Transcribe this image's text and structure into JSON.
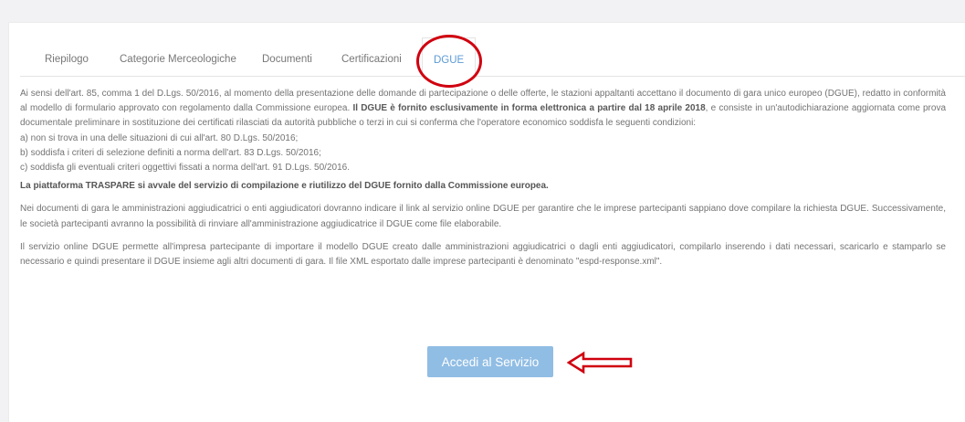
{
  "tabs": [
    {
      "label": "Riepilogo"
    },
    {
      "label": "Categorie Merceologiche"
    },
    {
      "label": "Documenti"
    },
    {
      "label": "Certificazioni"
    },
    {
      "label": "DGUE"
    }
  ],
  "content": {
    "intro_before_bold": "Ai sensi dell'art. 85, comma 1 del D.Lgs. 50/2016, al momento della presentazione delle domande di partecipazione o delle offerte, le stazioni appaltanti accettano il documento di gara unico europeo (DGUE), redatto in conformità al modello di formulario approvato con regolamento dalla Commissione europea. ",
    "intro_bold": "Il DGUE è fornito esclusivamente in forma elettronica a partire dal 18 aprile 2018",
    "intro_after_bold": ", e consiste in un'autodichiarazione aggiornata come prova documentale preliminare in sostituzione dei certificati rilasciati da autorità pubbliche o terzi in cui si conferma che l'operatore economico soddisfa le seguenti condizioni:",
    "condition_a": "a) non si trova in una delle situazioni di cui all'art. 80 D.Lgs. 50/2016;",
    "condition_b": "b) soddisfa i criteri di selezione definiti a norma dell'art. 83 D.Lgs. 50/2016;",
    "condition_c": "c) soddisfa gli eventuali criteri oggettivi fissati a norma dell'art. 91 D.Lgs. 50/2016.",
    "platform_note": "La piattaforma TRASPARE si avvale del servizio di compilazione e riutilizzo del DGUE fornito dalla Commissione europea.",
    "para_documents": "Nei documenti di gara le amministrazioni aggiudicatrici o enti aggiudicatori dovranno indicare il link al servizio online DGUE per garantire che le imprese partecipanti sappiano dove compilare la richiesta DGUE. Successivamente, le società partecipanti avranno la possibilità di rinviare all'amministrazione aggiudicatrice il DGUE come file elaborabile.",
    "para_service": "Il servizio online DGUE permette all'impresa partecipante di importare il modello DGUE creato dalle amministrazioni aggiudicatrici o dagli enti aggiudicatori, compilarlo inserendo i dati necessari, scaricarlo e stamparlo se necessario e quindi presentare il DGUE insieme agli altri documenti di gara. Il file XML esportato dalle imprese partecipanti è denominato \"espd-response.xml\"."
  },
  "button": {
    "label": "Accedi al Servizio"
  },
  "colors": {
    "accent": "#5b9bd5",
    "button": "#90bde4",
    "annotation": "#d0000f"
  }
}
